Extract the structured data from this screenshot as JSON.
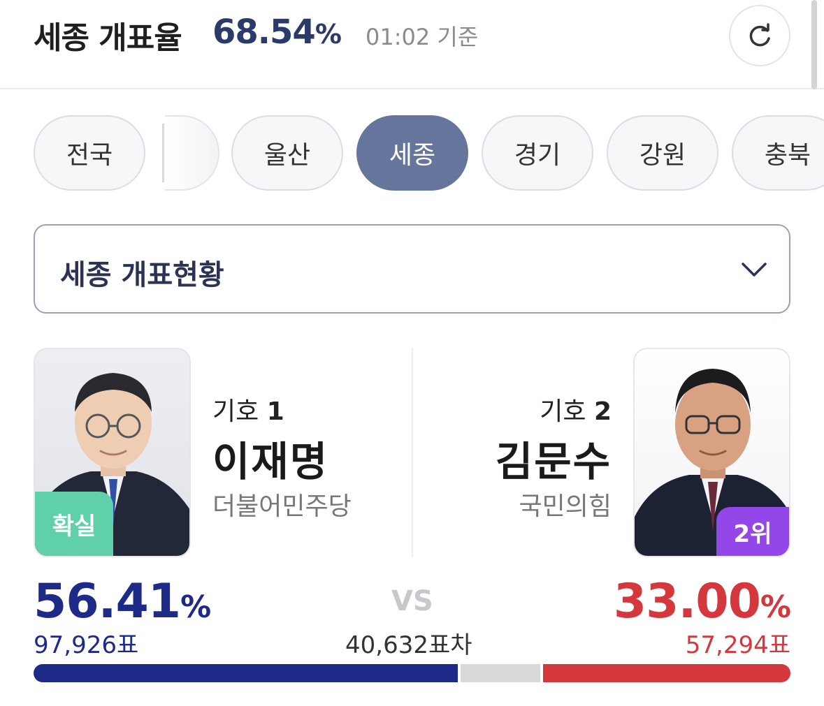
{
  "header": {
    "title": "세종 개표율",
    "count_rate_value": "68.54",
    "count_rate_unit": "%",
    "as_of": "01:02 기준",
    "refresh_icon": "refresh-icon"
  },
  "region_tabs": [
    {
      "label": "전국",
      "active": false
    },
    {
      "label": "울산",
      "active": false
    },
    {
      "label": "세종",
      "active": true
    },
    {
      "label": "경기",
      "active": false
    },
    {
      "label": "강원",
      "active": false
    },
    {
      "label": "충북",
      "active": false
    }
  ],
  "dropdown": {
    "label": "세종 개표현황",
    "icon": "chevron-down-icon"
  },
  "candidates": {
    "left": {
      "number_label": "기호",
      "number": "1",
      "name": "이재명",
      "party": "더불어민주당",
      "badge": "확실",
      "percent": "56.41",
      "percent_unit": "%",
      "votes": "97,926표",
      "color": "#1e2a88"
    },
    "right": {
      "number_label": "기호",
      "number": "2",
      "name": "김문수",
      "party": "국민의힘",
      "badge": "2위",
      "percent": "33.00",
      "percent_unit": "%",
      "votes": "57,294표",
      "color": "#d4383d"
    }
  },
  "versus": {
    "label": "VS",
    "margin": "40,632표차"
  },
  "vote_bar": {
    "left_share": 0.5641,
    "right_share": 0.33
  }
}
